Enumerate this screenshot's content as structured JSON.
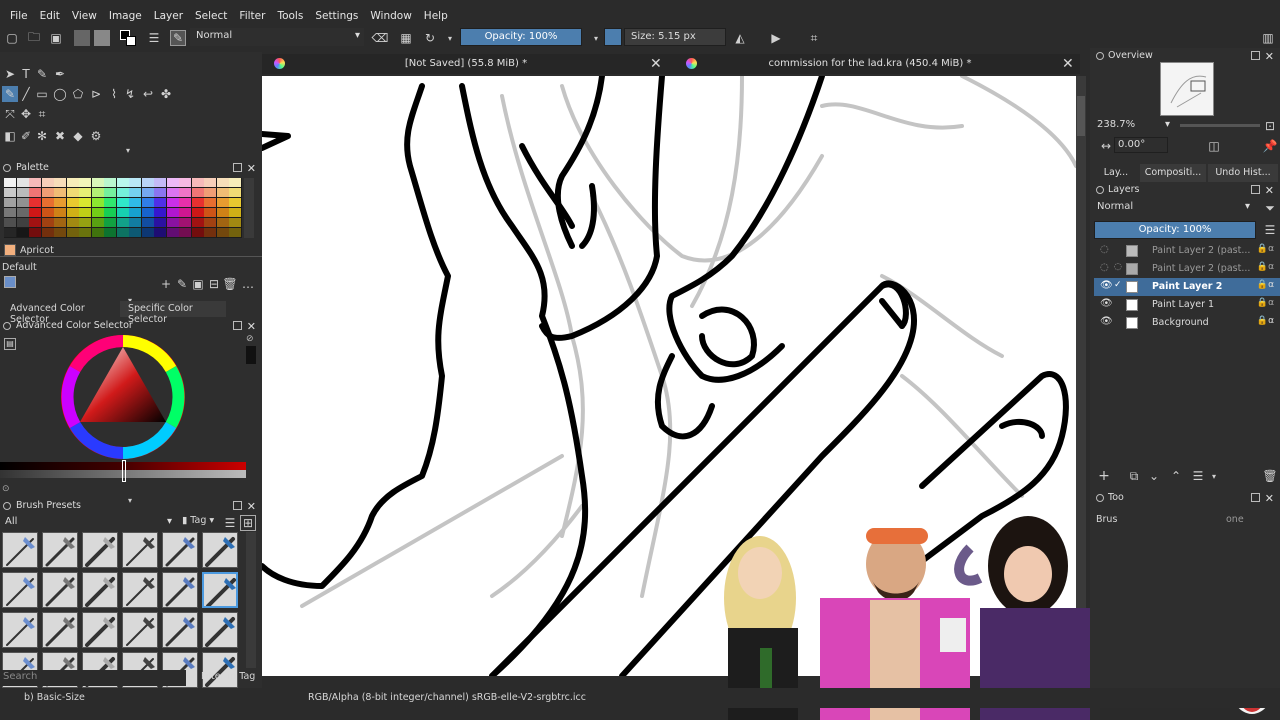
{
  "menu": [
    "File",
    "Edit",
    "View",
    "Image",
    "Layer",
    "Select",
    "Filter",
    "Tools",
    "Settings",
    "Window",
    "Help"
  ],
  "toolbar": {
    "blend_mode": "Normal",
    "opacity": "Opacity: 100%",
    "size": "Size: 5.15 px"
  },
  "tabs": [
    {
      "title": "[Not Saved]  (55.8 MiB) *"
    },
    {
      "title": "commission for the lad.kra  (450.4 MiB) *"
    }
  ],
  "palette": {
    "title": "Palette",
    "selected_color": "Apricot",
    "preset": "Default"
  },
  "color_tabs": [
    "Advanced Color Selector",
    "Specific Color Selector"
  ],
  "color_selector": {
    "title": "Advanced Color Selector"
  },
  "brush_presets": {
    "title": "Brush Presets",
    "filter": "All",
    "tag": "Tag",
    "search_placeholder": "Search",
    "filter_in_tag": "Filter in Tag"
  },
  "overview": {
    "title": "Overview",
    "zoom": "238.7%",
    "rotation": "0.00°"
  },
  "right_tabs": [
    "Lay...",
    "Compositi...",
    "Undo Hist..."
  ],
  "layers": {
    "title": "Layers",
    "blend_mode": "Normal",
    "opacity": "Opacity:  100%",
    "items": [
      {
        "name": "Paint Layer 2 (past...",
        "visible": false,
        "active": false
      },
      {
        "name": "Paint Layer 2 (past...",
        "visible": false,
        "active": false
      },
      {
        "name": "Paint Layer 2",
        "visible": true,
        "active": true
      },
      {
        "name": "Paint Layer 1",
        "visible": true,
        "active": false
      },
      {
        "name": "Background",
        "visible": true,
        "active": false,
        "locked": true
      }
    ]
  },
  "tool_options": {
    "title": "Too",
    "brush_label": "Brus",
    "value": "one"
  },
  "status": {
    "left": "b) Basic-Size",
    "color_space": "RGB/Alpha (8-bit integer/channel)  sRGB-elle-V2-srgbtrc.icc"
  },
  "colors": {
    "accent": "#4c7eae",
    "panel": "#2e2e2e",
    "canvas": "#ffffff"
  }
}
